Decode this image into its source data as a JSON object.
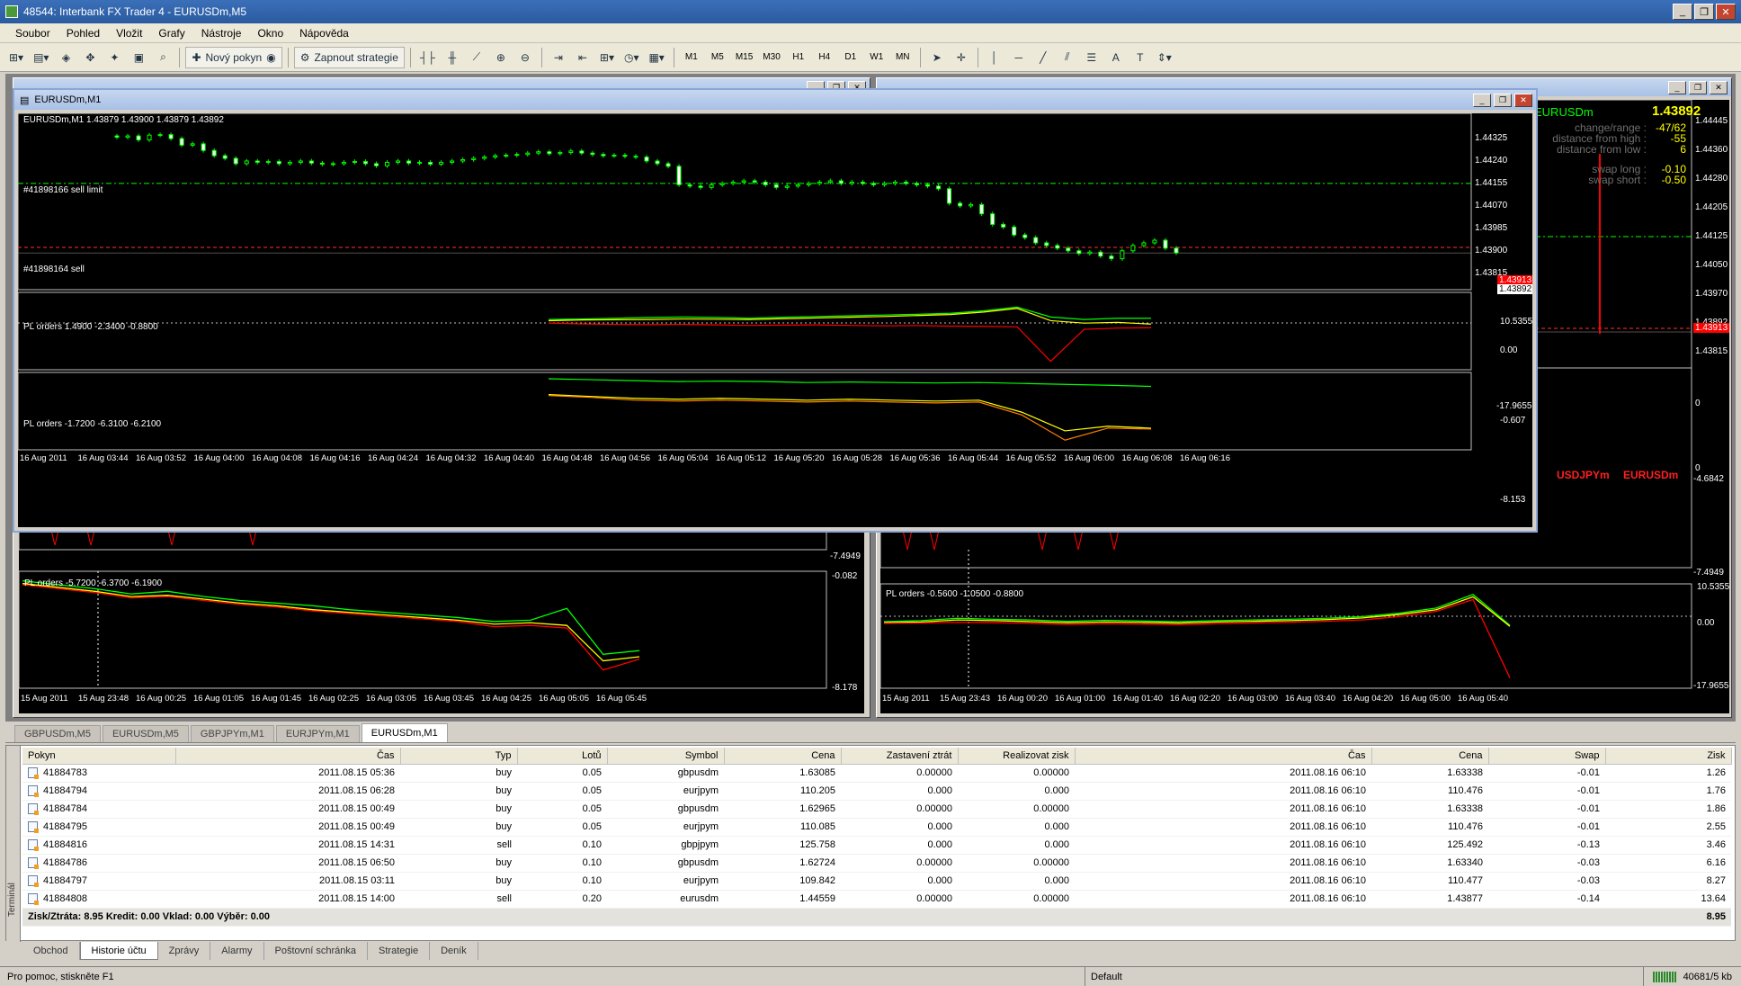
{
  "window": {
    "title": "48544: Interbank FX Trader 4 - EURUSDm,M5"
  },
  "menu": [
    "Soubor",
    "Pohled",
    "Vložit",
    "Grafy",
    "Nástroje",
    "Okno",
    "Nápověda"
  ],
  "toolbar": {
    "new_order": "Nový pokyn",
    "strategies": "Zapnout strategie",
    "timeframes": [
      "M1",
      "M5",
      "M15",
      "M30",
      "H1",
      "H4",
      "D1",
      "W1",
      "MN"
    ]
  },
  "charts": {
    "main": {
      "window_title": "EURUSDm,M1",
      "header": "EURUSDm,M1  1.43879 1.43900 1.43879 1.43892",
      "sell_limit_label": "#41898166 sell limit",
      "sell_label": "#41898164 sell",
      "price_ticks": [
        "1.44325",
        "1.44240",
        "1.44155",
        "1.44070",
        "1.43985",
        "1.43900",
        "1.43815"
      ],
      "current_price": "1.43892",
      "red_price_tag": "1.43913",
      "ind1_label": "PL orders 1.4900 -2.3400 -0.8800",
      "ind1_ticks": [
        "10.5355",
        "0.00",
        "-17.9655"
      ],
      "ind2_label": "PL orders -1.7200 -6.3100 -6.2100",
      "ind2_ticks": [
        "-0.607",
        "-8.153"
      ],
      "time_ticks": [
        "16 Aug 2011",
        "16 Aug 03:44",
        "16 Aug 03:52",
        "16 Aug 04:00",
        "16 Aug 04:08",
        "16 Aug 04:16",
        "16 Aug 04:24",
        "16 Aug 04:32",
        "16 Aug 04:40",
        "16 Aug 04:48",
        "16 Aug 04:56",
        "16 Aug 05:04",
        "16 Aug 05:12",
        "16 Aug 05:20",
        "16 Aug 05:28",
        "16 Aug 05:36",
        "16 Aug 05:44",
        "16 Aug 05:52",
        "16 Aug 06:00",
        "16 Aug 06:08",
        "16 Aug 06:16"
      ]
    },
    "right_top": {
      "symbol": "EURUSDm",
      "price": "1.43892",
      "rows": [
        {
          "label": "change/range :",
          "value": "-47/62"
        },
        {
          "label": "distance from high :",
          "value": "-55"
        },
        {
          "label": "distance from low :",
          "value": "6"
        },
        {
          "label": "swap long :",
          "value": "-0.10"
        },
        {
          "label": "swap short :",
          "value": "-0.50"
        }
      ],
      "price_ticks": [
        "1.44445",
        "1.44360",
        "1.44280",
        "1.44205",
        "1.44125",
        "1.44050",
        "1.43970",
        "1.43892",
        "1.43815"
      ],
      "red_tag": "1.43913",
      "extra_ticks": [
        "0",
        "0",
        "-4.6842",
        "-7.4949"
      ],
      "legend": [
        "USDJPYm",
        "EURUSDm"
      ]
    },
    "left_bottom": {
      "label": "PL orders -5.7200 -6.3700 -6.1900",
      "ticks": [
        "-0.082",
        "-8.178"
      ],
      "top_tick": "-7.4949",
      "time_ticks": [
        "15 Aug 2011",
        "15 Aug 23:48",
        "16 Aug 00:25",
        "16 Aug 01:05",
        "16 Aug 01:45",
        "16 Aug 02:25",
        "16 Aug 03:05",
        "16 Aug 03:45",
        "16 Aug 04:25",
        "16 Aug 05:05",
        "16 Aug 05:45"
      ]
    },
    "right_bottom": {
      "label": "PL orders -0.5600 -1.0500 -0.8800",
      "ticks": [
        "10.5355",
        "0.00",
        "-17.9655"
      ],
      "time_ticks": [
        "15 Aug 2011",
        "15 Aug 23:43",
        "16 Aug 00:20",
        "16 Aug 01:00",
        "16 Aug 01:40",
        "16 Aug 02:20",
        "16 Aug 03:00",
        "16 Aug 03:40",
        "16 Aug 04:20",
        "16 Aug 05:00",
        "16 Aug 05:40"
      ]
    }
  },
  "chart_tabs": [
    "GBPUSDm,M5",
    "EURUSDm,M5",
    "GBPJPYm,M1",
    "EURJPYm,M1",
    "EURUSDm,M1"
  ],
  "terminal": {
    "sidebar_label": "Terminál",
    "columns": [
      "Pokyn",
      "Čas",
      "Typ",
      "Lotů",
      "Symbol",
      "Cena",
      "Zastavení ztrát",
      "Realizovat zisk",
      "Čas",
      "Cena",
      "Swap",
      "Zisk"
    ],
    "rows": [
      [
        "41884783",
        "2011.08.15 05:36",
        "buy",
        "0.05",
        "gbpusdm",
        "1.63085",
        "0.00000",
        "0.00000",
        "2011.08.16 06:10",
        "1.63338",
        "-0.01",
        "1.26"
      ],
      [
        "41884794",
        "2011.08.15 06:28",
        "buy",
        "0.05",
        "eurjpym",
        "110.205",
        "0.000",
        "0.000",
        "2011.08.16 06:10",
        "110.476",
        "-0.01",
        "1.76"
      ],
      [
        "41884784",
        "2011.08.15 00:49",
        "buy",
        "0.05",
        "gbpusdm",
        "1.62965",
        "0.00000",
        "0.00000",
        "2011.08.16 06:10",
        "1.63338",
        "-0.01",
        "1.86"
      ],
      [
        "41884795",
        "2011.08.15 00:49",
        "buy",
        "0.05",
        "eurjpym",
        "110.085",
        "0.000",
        "0.000",
        "2011.08.16 06:10",
        "110.476",
        "-0.01",
        "2.55"
      ],
      [
        "41884816",
        "2011.08.15 14:31",
        "sell",
        "0.10",
        "gbpjpym",
        "125.758",
        "0.000",
        "0.000",
        "2011.08.16 06:10",
        "125.492",
        "-0.13",
        "3.46"
      ],
      [
        "41884786",
        "2011.08.15 06:50",
        "buy",
        "0.10",
        "gbpusdm",
        "1.62724",
        "0.00000",
        "0.00000",
        "2011.08.16 06:10",
        "1.63340",
        "-0.03",
        "6.16"
      ],
      [
        "41884797",
        "2011.08.15 03:11",
        "buy",
        "0.10",
        "eurjpym",
        "109.842",
        "0.000",
        "0.000",
        "2011.08.16 06:10",
        "110.477",
        "-0.03",
        "8.27"
      ],
      [
        "41884808",
        "2011.08.15 14:00",
        "sell",
        "0.20",
        "eurusdm",
        "1.44559",
        "0.00000",
        "0.00000",
        "2011.08.16 06:10",
        "1.43877",
        "-0.14",
        "13.64"
      ]
    ],
    "total_label": "Zisk/Ztráta: 8.95  Kredit: 0.00  Vklad: 0.00  Výběr: 0.00",
    "total_value": "8.95",
    "tabs": [
      "Obchod",
      "Historie účtu",
      "Zprávy",
      "Alarmy",
      "Poštovní schránka",
      "Strategie",
      "Deník"
    ]
  },
  "status": {
    "help": "Pro pomoc, stiskněte F1",
    "profile": "Default",
    "traffic": "40681/5 kb"
  },
  "colors": {
    "bull": "#00ff00",
    "bear": "#ff0000",
    "yellow": "#ffff00",
    "orange": "#ff8000"
  },
  "chart_data": [
    {
      "type": "candlestick",
      "title": "EURUSDm,M1  1.43879 1.43900 1.43879 1.43892",
      "ylim": [
        1.4378,
        1.444
      ],
      "y_ticks": [
        1.44325,
        1.4424,
        1.44155,
        1.4407,
        1.43985,
        1.439,
        1.43815
      ],
      "hlines": [
        {
          "name": "#41898166 sell limit",
          "y": 1.44155
        },
        {
          "name": "#41898164 sell",
          "y": 1.43913
        }
      ],
      "close": [
        1.4433,
        1.44335,
        1.4432,
        1.44338,
        1.4434,
        1.44325,
        1.443,
        1.44305,
        1.4428,
        1.4426,
        1.4425,
        1.4423,
        1.4424,
        1.44235,
        1.44238,
        1.4423,
        1.44235,
        1.4424,
        1.44232,
        1.44228,
        1.4423,
        1.44235,
        1.44238,
        1.4423,
        1.44222,
        1.44235,
        1.4424,
        1.44232,
        1.44235,
        1.44228,
        1.44235,
        1.4424,
        1.44245,
        1.4425,
        1.44255,
        1.4426,
        1.44262,
        1.44265,
        1.4427,
        1.44275,
        1.44268,
        1.44272,
        1.44278,
        1.4427,
        1.44265,
        1.4426,
        1.44262,
        1.44258,
        1.44255,
        1.4424,
        1.4423,
        1.4422,
        1.4415,
        1.44145,
        1.4414,
        1.4415,
        1.44155,
        1.4416,
        1.44165,
        1.4416,
        1.4415,
        1.4414,
        1.44145,
        1.4415,
        1.44155,
        1.4416,
        1.44165,
        1.44155,
        1.4416,
        1.44155,
        1.4415,
        1.44155,
        1.4416,
        1.44155,
        1.4415,
        1.44145,
        1.44135,
        1.4408,
        1.4407,
        1.44075,
        1.4404,
        1.44,
        1.4399,
        1.4396,
        1.4395,
        1.4393,
        1.4392,
        1.4391,
        1.439,
        1.4389,
        1.43895,
        1.4388,
        1.4387,
        1.439,
        1.4392,
        1.4393,
        1.4394,
        1.4391,
        1.43892
      ]
    },
    {
      "type": "line",
      "title": "PL orders 1.4900 -2.3400 -0.8800",
      "ylim": [
        -17.9655,
        10.5355
      ],
      "series": [
        {
          "color": "#00ff00",
          "values": [
            1.0,
            1.2,
            1.5,
            1.8,
            2.0,
            1.8,
            1.5,
            1.9,
            2.2,
            2.5,
            2.8,
            3.1,
            3.5,
            4.5,
            6.0,
            2.0,
            1.0,
            1.5,
            1.49
          ]
        },
        {
          "color": "#ffff00",
          "values": [
            0.5,
            0.8,
            0.9,
            1.0,
            1.2,
            1.1,
            1.0,
            1.3,
            1.6,
            1.9,
            2.2,
            2.6,
            3.0,
            4.0,
            5.5,
            0.5,
            -0.5,
            -0.2,
            -0.88
          ]
        },
        {
          "color": "#ff0000",
          "values": [
            -0.5,
            -0.8,
            -1.0,
            -1.1,
            -1.0,
            -1.2,
            -1.4,
            -1.3,
            -1.2,
            -1.4,
            -1.6,
            -1.5,
            -1.7,
            -1.8,
            -2.0,
            -16.0,
            -3.0,
            -2.5,
            -2.34
          ]
        }
      ]
    },
    {
      "type": "line",
      "title": "PL orders -1.7200 -6.3100 -6.2100",
      "ylim": [
        -8.153,
        -0.607
      ],
      "series": [
        {
          "color": "#00ff00",
          "values": [
            -0.9,
            -1.0,
            -1.1,
            -1.2,
            -1.15,
            -1.2,
            -1.3,
            -1.25,
            -1.3,
            -1.35,
            -1.3,
            -1.4,
            -1.5,
            -1.6,
            -1.72
          ]
        },
        {
          "color": "#ffff00",
          "values": [
            -2.6,
            -2.8,
            -3.0,
            -3.1,
            -3.0,
            -3.1,
            -3.2,
            -3.1,
            -3.2,
            -3.3,
            -3.2,
            -4.5,
            -6.5,
            -6.0,
            -6.21
          ]
        },
        {
          "color": "#ff8000",
          "values": [
            -2.7,
            -2.9,
            -3.2,
            -3.3,
            -3.2,
            -3.3,
            -3.4,
            -3.3,
            -3.4,
            -3.5,
            -3.4,
            -4.8,
            -7.5,
            -6.2,
            -6.31
          ]
        }
      ]
    },
    {
      "type": "line",
      "title": "PL orders -5.7200 -6.3700 -6.1900",
      "ylim": [
        -8.178,
        -0.082
      ],
      "series": [
        {
          "color": "#00ff00",
          "values": [
            -0.4,
            -0.7,
            -1.0,
            -1.4,
            -1.2,
            -1.6,
            -1.9,
            -2.1,
            -2.3,
            -2.6,
            -2.8,
            -3.0,
            -3.2,
            -3.5,
            -3.4,
            -2.5,
            -6.0,
            -5.72
          ]
        },
        {
          "color": "#ffff00",
          "values": [
            -0.6,
            -0.9,
            -1.2,
            -1.6,
            -1.5,
            -1.8,
            -2.1,
            -2.3,
            -2.6,
            -2.8,
            -3.0,
            -3.2,
            -3.4,
            -3.7,
            -3.6,
            -3.8,
            -6.5,
            -6.19
          ]
        },
        {
          "color": "#ff0000",
          "values": [
            -0.7,
            -1.0,
            -1.3,
            -1.7,
            -1.6,
            -1.9,
            -2.2,
            -2.4,
            -2.7,
            -2.9,
            -3.1,
            -3.3,
            -3.5,
            -3.9,
            -3.8,
            -4.0,
            -7.2,
            -6.37
          ]
        }
      ]
    },
    {
      "type": "line",
      "title": "PL orders -0.5600 -1.0500 -0.8800",
      "ylim": [
        -17.9655,
        10.5355
      ],
      "series": [
        {
          "color": "#00ff00",
          "values": [
            0.5,
            0.8,
            1.5,
            1.2,
            1.0,
            0.6,
            0.9,
            0.7,
            0.5,
            0.8,
            1.0,
            1.2,
            1.5,
            2.0,
            3.0,
            4.5,
            8.5,
            -0.56
          ]
        },
        {
          "color": "#ffff00",
          "values": [
            0.2,
            0.4,
            1.0,
            0.8,
            0.5,
            0.2,
            0.4,
            0.3,
            0.1,
            0.4,
            0.6,
            0.8,
            1.1,
            1.6,
            2.6,
            4.0,
            7.8,
            -0.88
          ]
        },
        {
          "color": "#ff0000",
          "values": [
            0.0,
            0.1,
            0.3,
            0.2,
            0.0,
            -0.3,
            -0.1,
            -0.2,
            -0.4,
            -0.1,
            0.1,
            0.3,
            0.6,
            1.0,
            2.0,
            3.5,
            7.0,
            -16.0
          ]
        }
      ]
    }
  ]
}
